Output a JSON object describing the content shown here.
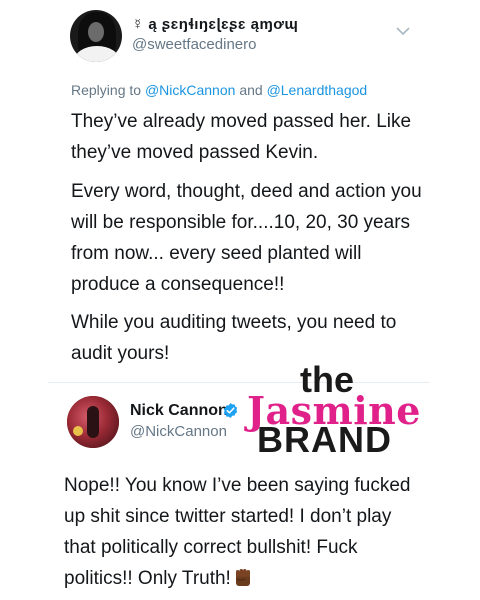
{
  "tweet1": {
    "display_name": "☿ ą ʂɛŋɬıŋɛɭɛʂɛ ąɱơɰ",
    "handle": "@sweetfacedinero",
    "replying_to_prefix": "Replying to",
    "reply_mention_1": "@NickCannon",
    "reply_and": "and",
    "reply_mention_2": "@Lenardthagod",
    "paragraphs": [
      "They’ve already moved passed her. Like they’ve moved passed Kevin.",
      "Every word, thought, deed and action you will be responsible for....10, 20, 30 years from now... every seed planted will produce a consequence!!",
      "While you auditing tweets, you need to audit yours!"
    ]
  },
  "tweet2": {
    "display_name": "Nick Cannon",
    "handle": "@NickCannon",
    "text": "Nope!! You know I’ve been saying fucked up shit since twitter started! I don’t play that politically correct bullshit! Fuck politics!! Only Truth!"
  },
  "watermark": {
    "line1": "the",
    "line2": "Jasmine",
    "line3": "BRAND"
  },
  "icons": {
    "chevron": "chevron-down-icon",
    "verified": "verified-badge-icon",
    "emoji": "raised-fist-emoji-icon"
  },
  "colors": {
    "link": "#1b95e0",
    "secondary_text": "#657786",
    "verified": "#1da1f2",
    "watermark_pink": "#e0218a"
  }
}
